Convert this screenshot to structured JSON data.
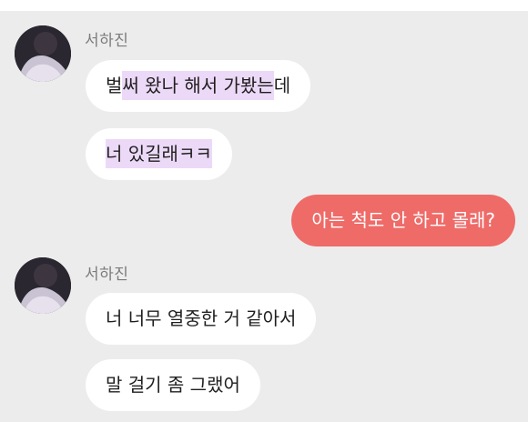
{
  "top_bar_color": "#ffffff",
  "colors": {
    "background": "#ececec",
    "incoming_bubble": "#ffffff",
    "outgoing_bubble": "#ee6b68",
    "highlight": "#ecd9f7"
  },
  "messages": [
    {
      "sender": "서하진",
      "avatar": "profile-photo",
      "bubbles": [
        {
          "pre": "벌",
          "highlight": "써 왔나 해서 가봤는",
          "post": "데"
        },
        {
          "pre": "",
          "highlight": "너 있길래ㅋㅋ",
          "post": ""
        }
      ]
    },
    {
      "mine": true,
      "text": "아는 척도 안 하고 몰래?"
    },
    {
      "sender": "서하진",
      "avatar": "profile-photo",
      "bubbles": [
        {
          "text": "너 너무 열중한 거 같아서"
        },
        {
          "text": "말 걸기 좀 그랬어"
        }
      ]
    }
  ]
}
